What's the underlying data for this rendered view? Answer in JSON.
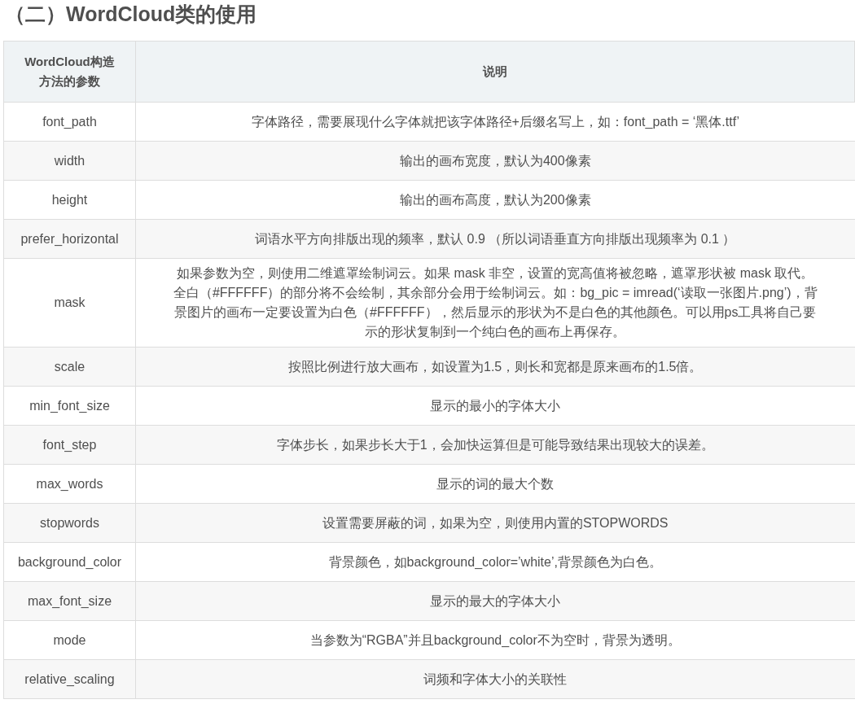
{
  "heading": "（二）WordCloud类的使用",
  "table": {
    "columns": [
      "WordCloud构造方法的参数",
      "说明"
    ],
    "rows": [
      {
        "param": "font_path",
        "description": [
          "字体路径，需要展现什么字体就把该字体路径+后缀名写上，如：font_path = ‘黑体.ttf’"
        ]
      },
      {
        "param": "width",
        "description": [
          "输出的画布宽度，默认为400像素"
        ]
      },
      {
        "param": "height",
        "description": [
          "输出的画布高度，默认为200像素"
        ]
      },
      {
        "param": "prefer_horizontal",
        "description": [
          "词语水平方向排版出现的频率，默认 0.9 （所以词语垂直方向排版出现频率为 0.1 ）"
        ]
      },
      {
        "param": "mask",
        "description": [
          "如果参数为空，则使用二维遮罩绘制词云。如果 mask 非空，设置的宽高值将被忽略，遮罩形状被 mask 取代。",
          "全白（#FFFFFF）的部分将不会绘制，其余部分会用于绘制词云。如：bg_pic = imread(‘读取一张图片.png’)，背",
          "景图片的画布一定要设置为白色（#FFFFFF），然后显示的形状为不是白色的其他颜色。可以用ps工具将自己要",
          "示的形状复制到一个纯白色的画布上再保存。"
        ]
      },
      {
        "param": "scale",
        "description": [
          "按照比例进行放大画布，如设置为1.5，则长和宽都是原来画布的1.5倍。"
        ]
      },
      {
        "param": "min_font_size",
        "description": [
          "显示的最小的字体大小"
        ]
      },
      {
        "param": "font_step",
        "description": [
          "字体步长，如果步长大于1，会加快运算但是可能导致结果出现较大的误差。"
        ]
      },
      {
        "param": "max_words",
        "description": [
          "显示的词的最大个数"
        ]
      },
      {
        "param": "stopwords",
        "description": [
          "设置需要屏蔽的词，如果为空，则使用内置的STOPWORDS"
        ]
      },
      {
        "param": "background_color",
        "description": [
          "背景颜色，如background_color=’white’,背景颜色为白色。"
        ]
      },
      {
        "param": "max_font_size",
        "description": [
          "显示的最大的字体大小"
        ]
      },
      {
        "param": "mode",
        "description": [
          "当参数为“RGBA”并且background_color不为空时，背景为透明。"
        ]
      },
      {
        "param": "relative_scaling",
        "description": [
          "词频和字体大小的关联性"
        ]
      }
    ]
  }
}
